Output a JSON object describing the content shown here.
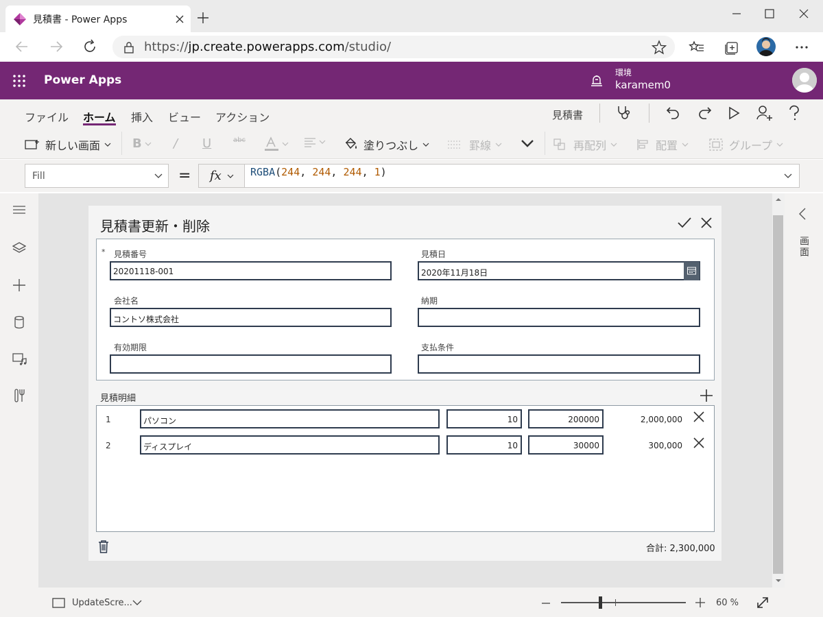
{
  "browser": {
    "tab_title": "見積書 - Power Apps",
    "url_prefix": "https://",
    "url_host": "jp.create.powerapps.com",
    "url_path": "/studio/"
  },
  "header": {
    "brand": "Power Apps",
    "env_label": "環境",
    "env_name": "karamem0"
  },
  "menu": {
    "items": [
      "ファイル",
      "ホーム",
      "挿入",
      "ビュー",
      "アクション"
    ],
    "active": "ホーム",
    "doc_name": "見積書"
  },
  "ribbon": {
    "new_screen": "新しい画面",
    "fill": "塗りつぶし",
    "border": "罫線",
    "reorder": "再配列",
    "align": "配置",
    "group": "グループ"
  },
  "formula_bar": {
    "property": "Fill",
    "equals": "=",
    "fx": "fx",
    "formula_fn": "RGBA",
    "formula_args": [
      "244",
      "244",
      "244",
      "1"
    ]
  },
  "right_panel": {
    "label": "画面"
  },
  "form": {
    "title": "見積書更新・削除",
    "required_mark": "*",
    "fields": {
      "quote_no": {
        "label": "見積番号",
        "value": "20201118-001"
      },
      "quote_date": {
        "label": "見積日",
        "value": "2020年11月18日"
      },
      "company": {
        "label": "会社名",
        "value": "コントソ株式会社"
      },
      "delivery": {
        "label": "納期",
        "value": ""
      },
      "expiry": {
        "label": "有効期限",
        "value": ""
      },
      "payment": {
        "label": "支払条件",
        "value": ""
      }
    },
    "lines_title": "見積明細",
    "lines": [
      {
        "no": "1",
        "item": "パソコン",
        "qty": "10",
        "price": "200000",
        "amount": "2,000,000"
      },
      {
        "no": "2",
        "item": "ディスプレイ",
        "qty": "10",
        "price": "30000",
        "amount": "300,000"
      }
    ],
    "total": "合計: 2,300,000"
  },
  "bottom": {
    "screen_name": "UpdateScre...",
    "zoom": "60 %",
    "zoom_level_fraction": 0.6
  },
  "colors": {
    "brand_purple": "#742774",
    "input_border": "#2e3b4e",
    "canvas_fill": "#f4f4f4"
  }
}
